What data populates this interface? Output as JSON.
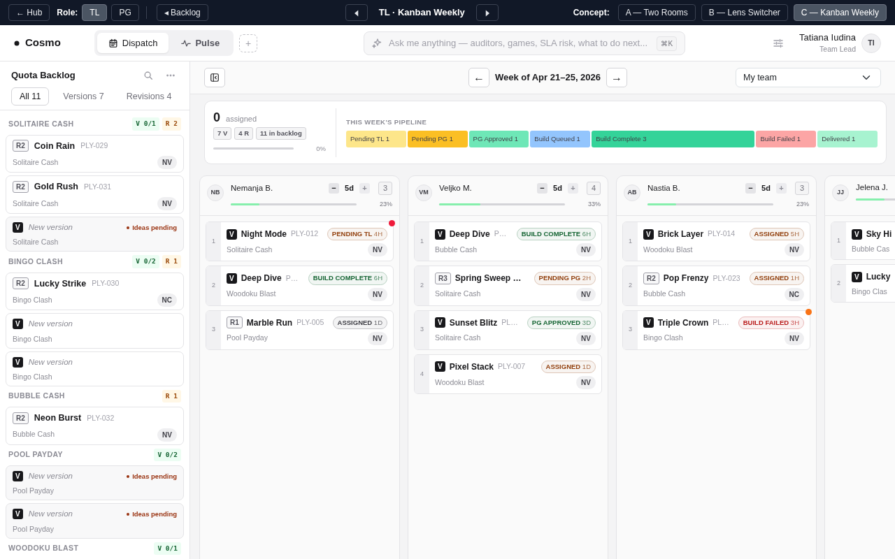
{
  "topbar": {
    "hub": "← Hub",
    "role_label": "Role:",
    "roles": [
      {
        "label": "TL",
        "selected": true
      },
      {
        "label": "PG",
        "selected": false
      }
    ],
    "backlog": "◂ Backlog",
    "title": "TL · Kanban Weekly",
    "concept_label": "Concept:",
    "concepts": [
      {
        "label": "A — Two Rooms",
        "selected": false
      },
      {
        "label": "B — Lens Switcher",
        "selected": false
      },
      {
        "label": "C — Kanban Weekly",
        "selected": true
      }
    ]
  },
  "header": {
    "logo": "Cosmo",
    "views": [
      {
        "label": "Dispatch",
        "kind": "calendar",
        "selected": true
      },
      {
        "label": "Pulse",
        "kind": "pulse",
        "selected": false
      }
    ],
    "add": "+",
    "search": {
      "placeholder": "Ask me anything — auditors, games, SLA risk, what to do next...",
      "shortcut": "⌘K"
    },
    "user": {
      "name": "Tatiana Iudina",
      "role": "Team Lead",
      "initials": "TI"
    }
  },
  "sidebar": {
    "title": "Quota Backlog",
    "tabs": [
      {
        "label": "All 11",
        "selected": true
      },
      {
        "label": "Versions 7",
        "selected": false
      },
      {
        "label": "Revisions 4",
        "selected": false
      }
    ],
    "groups": [
      {
        "name": "SOLITAIRE CASH",
        "counters": [
          {
            "kind": "version",
            "label": "V 0/1"
          },
          {
            "kind": "revision",
            "label": "R 2"
          }
        ],
        "items": [
          {
            "kind": "revision",
            "badge": "R2",
            "title": "Coin Rain",
            "id": "PLY-029",
            "game": "Solitaire Cash",
            "tag": "NV"
          },
          {
            "kind": "revision",
            "badge": "R2",
            "title": "Gold Rush",
            "id": "PLY-031",
            "game": "Solitaire Cash",
            "tag": "NV"
          },
          {
            "kind": "version",
            "badge": "V",
            "title": "New version",
            "status": "Ideas pending",
            "game": "Solitaire Cash"
          }
        ]
      },
      {
        "name": "BINGO CLASH",
        "counters": [
          {
            "kind": "version",
            "label": "V 0/2"
          },
          {
            "kind": "revision",
            "label": "R 1"
          }
        ],
        "items": [
          {
            "kind": "revision",
            "badge": "R2",
            "title": "Lucky Strike",
            "id": "PLY-030",
            "game": "Bingo Clash",
            "tag": "NC"
          },
          {
            "kind": "version",
            "badge": "V",
            "title": "New version",
            "game": "Bingo Clash"
          },
          {
            "kind": "version",
            "badge": "V",
            "title": "New version",
            "game": "Bingo Clash"
          }
        ]
      },
      {
        "name": "BUBBLE CASH",
        "counters": [
          {
            "kind": "revision",
            "label": "R 1"
          }
        ],
        "items": [
          {
            "kind": "revision",
            "badge": "R2",
            "title": "Neon Burst",
            "id": "PLY-032",
            "game": "Bubble Cash",
            "tag": "NV"
          }
        ]
      },
      {
        "name": "POOL PAYDAY",
        "counters": [
          {
            "kind": "version",
            "label": "V 0/2"
          }
        ],
        "items": [
          {
            "kind": "version",
            "badge": "V",
            "title": "New version",
            "status": "Ideas pending",
            "game": "Pool Payday"
          },
          {
            "kind": "version",
            "badge": "V",
            "title": "New version",
            "status": "Ideas pending",
            "game": "Pool Payday"
          }
        ]
      },
      {
        "name": "WOODOKU BLAST",
        "counters": [
          {
            "kind": "version",
            "label": "V 0/1"
          }
        ]
      }
    ]
  },
  "toolbar": {
    "prev": "←",
    "week": "Week of Apr 21–25, 2026",
    "next": "→",
    "team": "My team"
  },
  "summary": {
    "count": "0",
    "count_label": "assigned",
    "chips": [
      "7 V",
      "4 R",
      "11 in backlog"
    ],
    "level": 0,
    "percent": "0%",
    "pipeline_title": "THIS WEEK'S PIPELINE",
    "stages": [
      {
        "label": "Pending TL",
        "count": "1",
        "color": "#fde68a"
      },
      {
        "label": "Pending PG",
        "count": "1",
        "color": "#fbbf24"
      },
      {
        "label": "PG Approved",
        "count": "1",
        "color": "#6ee7b7"
      },
      {
        "label": "Build Queued",
        "count": "1",
        "color": "#93c5fd"
      },
      {
        "label": "Build Complete",
        "count": "3",
        "color": "#34d399"
      },
      {
        "label": "Build Failed",
        "count": "1",
        "color": "#fca5a5"
      },
      {
        "label": "Delivered",
        "count": "1",
        "color": "#a7f3d0"
      }
    ]
  },
  "columns": [
    {
      "initials": "NB",
      "name": "Nemanja B.",
      "minus": "−",
      "days": "5d",
      "plus": "+",
      "count": "3",
      "level": 0.23,
      "percent": "23%",
      "cards": [
        {
          "number": "1",
          "badge": "V",
          "kind": "version",
          "title": "Night Mode",
          "id": "PLY-012",
          "status": {
            "label": "PENDING TL",
            "age": "4H",
            "color": "#92400e"
          },
          "game": "Solitaire Cash",
          "tag": "NV",
          "flag": {
            "color": "#ef1a3a"
          }
        },
        {
          "number": "2",
          "badge": "V",
          "kind": "version",
          "title": "Deep Dive",
          "id": "P…",
          "status": {
            "label": "BUILD COMPLETE",
            "age": "6H",
            "color": "#166534"
          },
          "game": "Woodoku Blast",
          "tag": "NV"
        },
        {
          "number": "3",
          "badge": "R1",
          "kind": "revision",
          "title": "Marble Run",
          "id": "PLY-005",
          "status": {
            "label": "ASSIGNED",
            "age": "1D",
            "color": "#3f3f46"
          },
          "game": "Pool Payday",
          "tag": "NV"
        }
      ]
    },
    {
      "initials": "VM",
      "name": "Veljko M.",
      "minus": "−",
      "days": "5d",
      "plus": "+",
      "count": "4",
      "level": 0.33,
      "percent": "33%",
      "cards": [
        {
          "number": "1",
          "badge": "V",
          "kind": "version",
          "title": "Deep Dive",
          "id": "P…",
          "status": {
            "label": "BUILD COMPLETE",
            "age": "6H",
            "color": "#166534"
          },
          "game": "Bubble Cash",
          "tag": "NV"
        },
        {
          "number": "2",
          "badge": "R3",
          "kind": "revision",
          "title": "Spring Sweep …",
          "status": {
            "label": "PENDING PG",
            "age": "2H",
            "color": "#92400e"
          },
          "game": "Solitaire Cash",
          "tag": "NV"
        },
        {
          "number": "3",
          "badge": "V",
          "kind": "version",
          "title": "Sunset Blitz",
          "id": "PL…",
          "status": {
            "label": "PG APPROVED",
            "age": "3D",
            "color": "#166534"
          },
          "game": "Solitaire Cash",
          "tag": "NV"
        },
        {
          "number": "4",
          "badge": "V",
          "kind": "version",
          "title": "Pixel Stack",
          "id": "PLY-007",
          "status": {
            "label": "ASSIGNED",
            "age": "1D",
            "color": "#92400e"
          },
          "game": "Woodoku Blast",
          "tag": "NV"
        }
      ]
    },
    {
      "initials": "AB",
      "name": "Nastia B.",
      "minus": "−",
      "days": "5d",
      "plus": "+",
      "count": "3",
      "level": 0.23,
      "percent": "23%",
      "cards": [
        {
          "number": "1",
          "badge": "V",
          "kind": "version",
          "title": "Brick Layer",
          "id": "PLY-014",
          "status": {
            "label": "ASSIGNED",
            "age": "5H",
            "color": "#92400e"
          },
          "game": "Woodoku Blast",
          "tag": "NV"
        },
        {
          "number": "2",
          "badge": "R2",
          "kind": "revision",
          "title": "Pop Frenzy",
          "id": "PLY-023",
          "status": {
            "label": "ASSIGNED",
            "age": "1H",
            "color": "#92400e"
          },
          "game": "Bubble Cash",
          "tag": "NC"
        },
        {
          "number": "3",
          "badge": "V",
          "kind": "version",
          "title": "Triple Crown",
          "id": "PL…",
          "status": {
            "label": "BUILD FAILED",
            "age": "3H",
            "color": "#b91c1c"
          },
          "game": "Bingo Clash",
          "tag": "NV",
          "flag": {
            "color": "#f97316"
          }
        }
      ]
    },
    {
      "initials": "JJ",
      "name": "Jelena J.",
      "level": 0.23,
      "cards": [
        {
          "number": "1",
          "badge": "V",
          "kind": "version",
          "title": "Sky Hi",
          "game": "Bubble Cas"
        },
        {
          "number": "2",
          "badge": "V",
          "kind": "version",
          "title": "Lucky",
          "game": "Bingo Clas"
        }
      ]
    }
  ]
}
